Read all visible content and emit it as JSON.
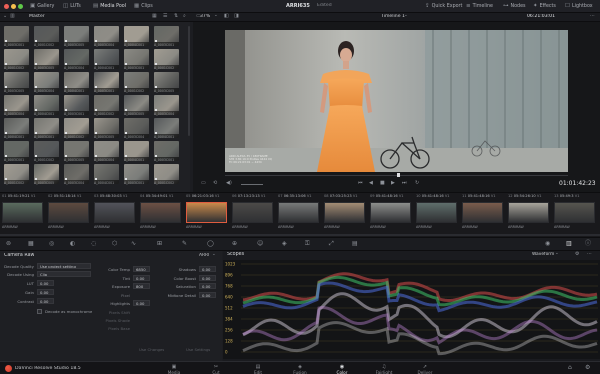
{
  "window": {
    "title": "ARRI635",
    "subtitle": "Edited"
  },
  "topbar": {
    "left_buttons": [
      "Gallery",
      "LUTs",
      "Media Pool",
      "Clips"
    ],
    "right_buttons": [
      "Quick Export",
      "Timeline",
      "Nodes",
      "Effects",
      "Lightbox"
    ]
  },
  "bar2": {
    "pool_title": "Master",
    "zoom": "37%",
    "timeline_name": "Timeline 1",
    "source_timecode": "06:21:03:01"
  },
  "media_pool": {
    "clip_labels": [
      "A_0003C001",
      "A_0001C002",
      "A_0003C005",
      "A_0003C004",
      "A_0004C001"
    ]
  },
  "viewer": {
    "overlay_text": [
      "ARRI ALEXA 35 / 180FRAME",
      "S35 3.8K 16:9 ProRes 4444 XQ",
      "TC 06:21:03:01 ~ 4434"
    ],
    "record_timecode": "01:01:42:23"
  },
  "timeline_clips": [
    {
      "num": "01",
      "tc": "05:41:19:21",
      "track": "V1",
      "codec": "ARRIRAW"
    },
    {
      "num": "02",
      "tc": "05:51:18:14",
      "track": "V1",
      "codec": "ARRIRAW"
    },
    {
      "num": "03",
      "tc": "05:48:30:03",
      "track": "V1",
      "codec": "ARRIRAW"
    },
    {
      "num": "04",
      "tc": "05:34:49:01",
      "track": "V1",
      "codec": "ARRIRAW"
    },
    {
      "num": "05",
      "tc": "06:21:03:16",
      "track": "V1",
      "codec": "ARRIRAW"
    },
    {
      "num": "06",
      "tc": "07:13:23:13",
      "track": "V1",
      "codec": "ARRIRAW"
    },
    {
      "num": "07",
      "tc": "06:35:13:06",
      "track": "V1",
      "codec": "ARRIRAW"
    },
    {
      "num": "08",
      "tc": "07:03:25:23",
      "track": "V1",
      "codec": "ARRIRAW"
    },
    {
      "num": "09",
      "tc": "05:41:48:16",
      "track": "V1",
      "codec": "ARRIRAW"
    },
    {
      "num": "10",
      "tc": "05:41:48:16",
      "track": "V1",
      "codec": "ARRIRAW"
    },
    {
      "num": "11",
      "tc": "05:41:48:16",
      "track": "V1",
      "codec": "ARRIRAW"
    },
    {
      "num": "12",
      "tc": "05:54:26:10",
      "track": "V1",
      "codec": "ARRIRAW"
    },
    {
      "num": "13",
      "tc": "05:49:3",
      "track": "V1",
      "codec": "ARRIRAW"
    }
  ],
  "camera_raw": {
    "title": "Camera Raw",
    "source": "ARRI",
    "decode_quality_label": "Decode Quality",
    "decode_quality": "Use project setting",
    "decode_using_label": "Decode Using",
    "decode_using": "Clip",
    "lut_label": "LUT",
    "gain_label": "Gain",
    "contrast_label": "Contrast",
    "lut_value": "0.00",
    "gain_value": "0.00",
    "contrast_value": "0.00",
    "mono_label": "Decode as monochrome",
    "color_temp_label": "Color Temp",
    "color_temp": "6850",
    "tint_label": "Tint",
    "tint": "0.00",
    "exposure_label": "Exposure",
    "exposure": "800",
    "highlights_label": "Highlights",
    "highlights": "0.00",
    "pixel_label": "Pixel",
    "shadows_label": "Shadows",
    "shadows": "0.00",
    "color_boost_label": "Color Boost",
    "color_boost": "0.00",
    "saturation_label": "Saturation",
    "saturation": "0.00",
    "midtone_label": "Midtone Detail",
    "midtone": "0.00",
    "dim_labels": [
      "Pixels Shift",
      "Pixels Shade",
      "Pixels Base"
    ],
    "use_changes": "Use Changes",
    "use_settings": "Use Settings"
  },
  "scopes": {
    "title": "Scopes",
    "mode": "Waveform",
    "scale": [
      "1023",
      "896",
      "768",
      "640",
      "512",
      "384",
      "256",
      "128",
      "0"
    ]
  },
  "bottom": {
    "app_name": "DaVinci Resolve Studio 18.5",
    "pages": [
      "Media",
      "Cut",
      "Edit",
      "Fusion",
      "Color",
      "Fairlight",
      "Deliver"
    ],
    "active_page": "Color"
  },
  "colors": {
    "accent": "#e0553f",
    "clip_active": "#e05c3f",
    "bg": "#1c1d21"
  }
}
